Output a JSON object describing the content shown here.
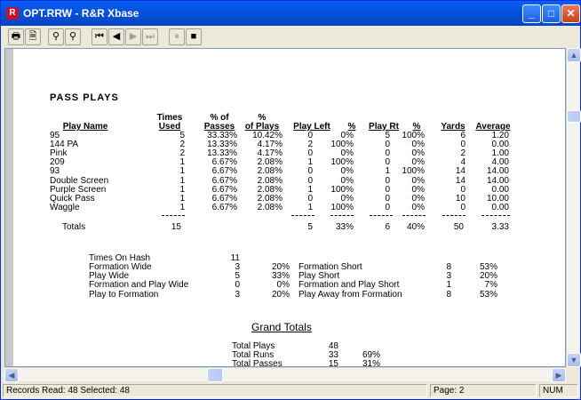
{
  "window": {
    "title": "OPT.RRW - R&R Xbase",
    "icon_glyph": "R"
  },
  "toolbar": {
    "buttons": [
      "🖶",
      "🗎",
      "⚲",
      "⚲",
      "⏮",
      "◀",
      "▶",
      "⏭",
      "⏸",
      "■"
    ]
  },
  "report": {
    "section_title": "PASS PLAYS",
    "headers": {
      "play_name": "Play Name",
      "times_top": "Times",
      "times_bot": "Used",
      "pct_pass_top": "% of",
      "pct_pass_bot": "Passes",
      "pct_plays_top": "%",
      "pct_plays_bot": "of Plays",
      "play_left": "Play Left",
      "pct_left": "%",
      "play_rt": "Play Rt",
      "pct_rt": "%",
      "yards": "Yards",
      "average": "Average"
    },
    "rows": [
      [
        "95",
        "5",
        "33.33%",
        "10.42%",
        "0",
        "0%",
        "5",
        "100%",
        "6",
        "1.20"
      ],
      [
        "144 PA",
        "2",
        "13.33%",
        "4.17%",
        "2",
        "100%",
        "0",
        "0%",
        "0",
        "0.00"
      ],
      [
        "Pink",
        "2",
        "13.33%",
        "4.17%",
        "0",
        "0%",
        "0",
        "0%",
        "2",
        "1.00"
      ],
      [
        "209",
        "1",
        "6.67%",
        "2.08%",
        "1",
        "100%",
        "0",
        "0%",
        "4",
        "4.00"
      ],
      [
        "93",
        "1",
        "6.67%",
        "2.08%",
        "0",
        "0%",
        "1",
        "100%",
        "14",
        "14.00"
      ],
      [
        "Double Screen",
        "1",
        "6.67%",
        "2.08%",
        "0",
        "0%",
        "0",
        "0%",
        "14",
        "14.00"
      ],
      [
        "Purple Screen",
        "1",
        "6.67%",
        "2.08%",
        "1",
        "100%",
        "0",
        "0%",
        "0",
        "0.00"
      ],
      [
        "Quick Pass",
        "1",
        "6.67%",
        "2.08%",
        "0",
        "0%",
        "0",
        "0%",
        "10",
        "10.00"
      ],
      [
        "Waggle",
        "1",
        "6.67%",
        "2.08%",
        "1",
        "100%",
        "0",
        "0%",
        "0",
        "0.00"
      ]
    ],
    "totals": {
      "label": "Totals",
      "times": "15",
      "left": "5",
      "left_pct": "33%",
      "rt": "6",
      "rt_pct": "40%",
      "yards": "50",
      "avg": "3.33"
    },
    "hash": {
      "label": "Times On Hash",
      "value": "11"
    },
    "formation": [
      {
        "l": "Formation Wide",
        "n": "3",
        "p": "20%",
        "l2": "Formation Short",
        "n2": "8",
        "p2": "53%"
      },
      {
        "l": "Play Wide",
        "n": "5",
        "p": "33%",
        "l2": "Play Short",
        "n2": "3",
        "p2": "20%"
      },
      {
        "l": "Formation and Play Wide",
        "n": "0",
        "p": "0%",
        "l2": "Formation and Play Short",
        "n2": "1",
        "p2": "7%"
      },
      {
        "l": "Play to Formation",
        "n": "3",
        "p": "20%",
        "l2": "Play Away from Formation",
        "n2": "8",
        "p2": "53%"
      }
    ],
    "grand": {
      "title": "Grand Totals",
      "rows": [
        [
          "Total Plays",
          "48",
          ""
        ],
        [
          "Total Runs",
          "33",
          "69%"
        ],
        [
          "Total Passes",
          "15",
          "31%"
        ]
      ]
    }
  },
  "status": {
    "records": "Records Read: 48  Selected: 48",
    "page": "Page:  2",
    "num": "NUM"
  }
}
